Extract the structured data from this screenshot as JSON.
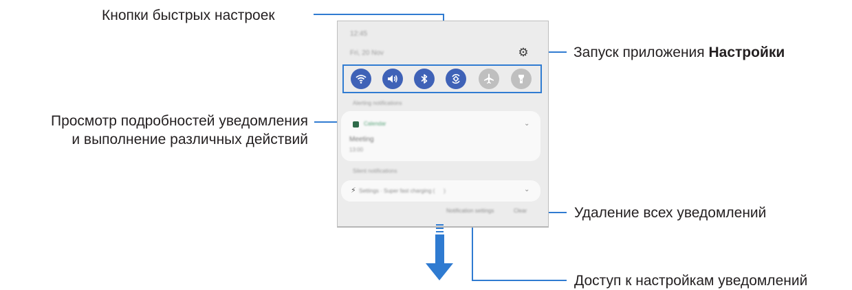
{
  "callouts": {
    "quick_settings_buttons": "Кнопки быстрых настроек",
    "launch_settings_prefix": "Запуск приложения ",
    "launch_settings_app": "Настройки",
    "view_details_line1": "Просмотр подробностей уведомления",
    "view_details_line2": "и выполнение различных действий",
    "clear_all": "Удаление всех уведомлений",
    "access_notification_settings": "Доступ к настройкам уведомлений"
  },
  "panel": {
    "time": "12:45",
    "date": "Fri, 20 Nov",
    "quick_settings": [
      {
        "icon": "wifi-icon",
        "state": "on"
      },
      {
        "icon": "sound-icon",
        "state": "on"
      },
      {
        "icon": "bluetooth-icon",
        "state": "on"
      },
      {
        "icon": "auto-rotate-icon",
        "state": "on"
      },
      {
        "icon": "airplane-icon",
        "state": "off"
      },
      {
        "icon": "flashlight-icon",
        "state": "off"
      }
    ],
    "alerting_section": "Alerting notifications",
    "notification_app": "Calendar",
    "notification_title": "Meeting",
    "notification_time": "13:00",
    "silent_section": "Silent notifications",
    "silent_notification": "Settings · Super fast charging (        )",
    "notification_settings_btn": "Notification settings",
    "clear_btn": "Clear"
  },
  "colors": {
    "accent": "#2f7bd1",
    "toggle_on": "#3f62b7",
    "toggle_off": "#bfbfbf"
  }
}
